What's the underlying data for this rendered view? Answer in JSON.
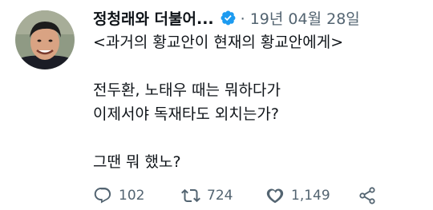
{
  "author": {
    "display_name": "정청래와 더불어...",
    "verified": true,
    "date": "· 19년 04월 28일"
  },
  "tweet": {
    "lines": [
      "<과거의 황교안이 현재의 황교안에게>",
      "전두환, 노태우 때는 뭐하다가",
      "이제서야 독재타도 외치는가?",
      "그땐 뭐 했노?"
    ]
  },
  "actions": {
    "reply_count": "102",
    "retweet_count": "724",
    "like_count": "1,149",
    "icons": [
      "reply-icon",
      "retweet-icon",
      "like-icon",
      "share-icon"
    ]
  },
  "colors": {
    "text": "#0f1419",
    "secondary": "#536471",
    "verified": "#1d9bf0"
  }
}
